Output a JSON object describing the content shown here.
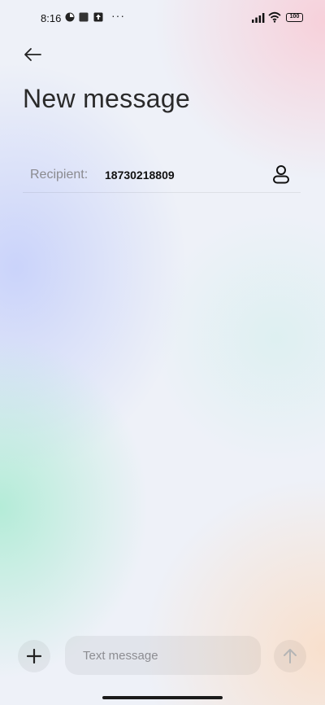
{
  "status_bar": {
    "time": "8:16",
    "battery": "100",
    "more": "···",
    "icons": [
      "pie-icon",
      "square-app-icon",
      "upload-icon",
      "signal-icon",
      "wifi-icon",
      "battery-icon"
    ]
  },
  "header": {
    "title": "New message",
    "back_icon": "back-arrow-icon"
  },
  "recipient": {
    "label": "Recipient:",
    "value": "18730218809",
    "contact_icon": "person-icon"
  },
  "composer": {
    "placeholder": "Text message",
    "value": "",
    "add_icon": "plus-icon",
    "send_icon": "arrow-up-icon"
  },
  "colors": {
    "accent": "#1a1a1a",
    "muted_text": "#8a8a8f",
    "send_disabled": "#b5b5b5"
  }
}
